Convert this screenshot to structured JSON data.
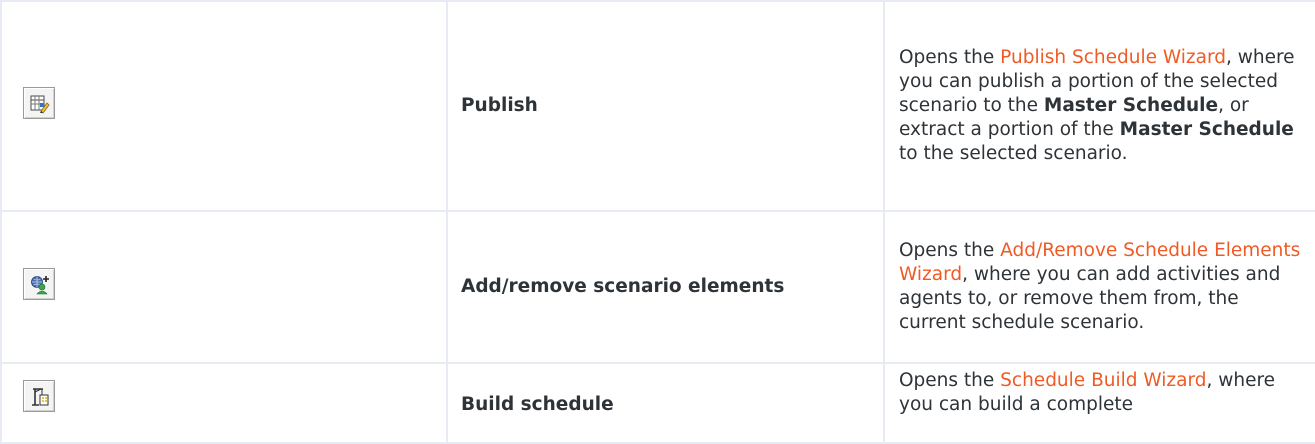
{
  "rows": [
    {
      "icon": "publish-icon",
      "name": "Publish",
      "desc": {
        "prefix": "Opens the ",
        "link": "Publish Schedule Wizard",
        "middle1": ", where you can publish a portion of the selected scenario to the ",
        "bold1": "Master Schedule",
        "middle2": ", or extract a portion of the ",
        "bold2": "Master Schedule",
        "suffix": " to the selected scenario."
      }
    },
    {
      "icon": "add-remove-elements-icon",
      "name": "Add/remove scenario elements",
      "desc": {
        "prefix": "Opens the ",
        "link": "Add/Remove Schedule Elements Wizard",
        "suffix": ", where you can add activities and agents to, or remove them from, the current schedule scenario."
      }
    },
    {
      "icon": "build-schedule-icon",
      "name": "Build schedule",
      "desc": {
        "prefix": "Opens the ",
        "link": "Schedule Build Wizard",
        "suffix": ", where you can build a complete"
      }
    }
  ],
  "colors": {
    "link": "#f05a24",
    "text": "#2e3338",
    "border": "#e8ebf3"
  }
}
